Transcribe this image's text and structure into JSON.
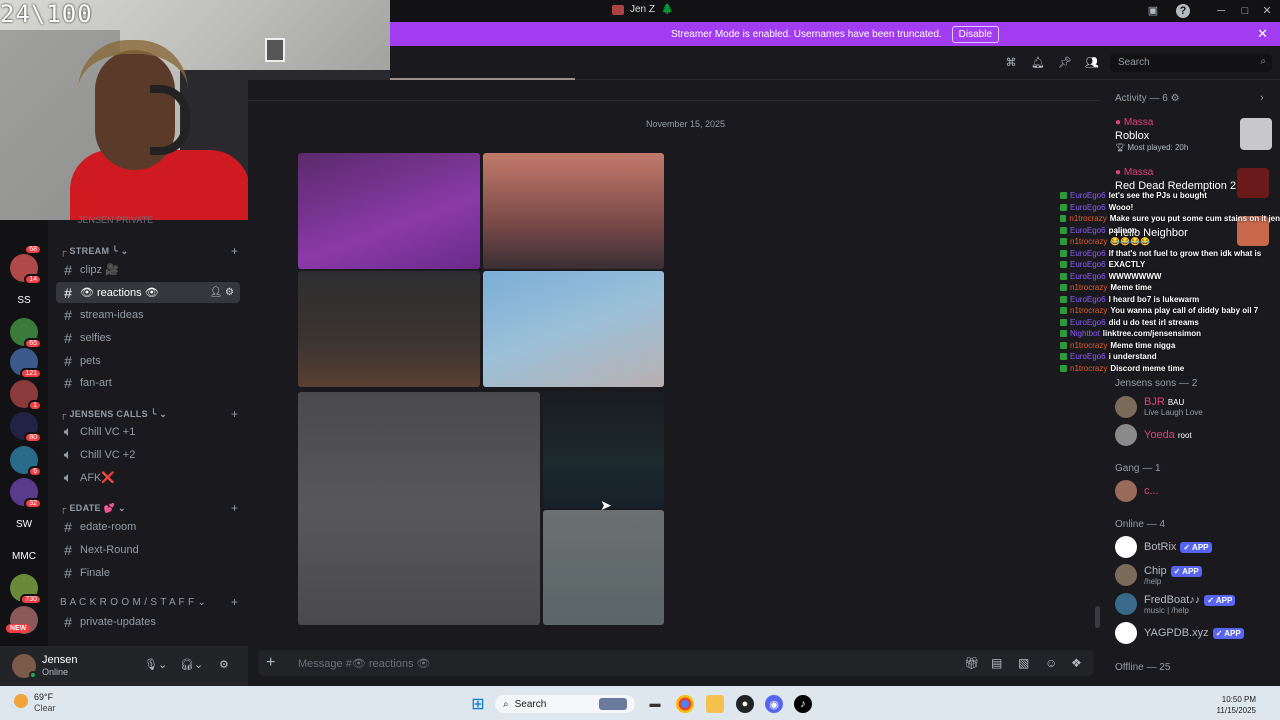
{
  "window": {
    "title": "Jen Z",
    "title_emoji": "🌲",
    "controls": [
      "minimize",
      "maximize",
      "close"
    ]
  },
  "webcam_overlay": "24\\100",
  "banner": {
    "text": "Streamer Mode is enabled. Usernames have been truncated.",
    "button": "Disable"
  },
  "header": {
    "search_placeholder": "Search"
  },
  "guilds": [
    {
      "label": "",
      "badge": "68",
      "color": "#6a5a4a"
    },
    {
      "label": "",
      "badge": "14",
      "color": "#b04a4a"
    },
    {
      "label": "SS",
      "badge": "",
      "color": "#121214"
    },
    {
      "label": "",
      "badge": "65",
      "color": "#3a7a3a"
    },
    {
      "label": "",
      "badge": "121",
      "color": "#3a5a8a"
    },
    {
      "label": "",
      "badge": "1",
      "color": "#8a3a3a"
    },
    {
      "label": "",
      "badge": "80",
      "color": "#222244"
    },
    {
      "label": "",
      "badge": "6",
      "color": "#2a6a8a"
    },
    {
      "label": "",
      "badge": "32",
      "color": "#5a3a8a"
    },
    {
      "label": "SW",
      "badge": "",
      "color": "#121214"
    },
    {
      "label": "MMC",
      "badge": "",
      "color": "#121214"
    },
    {
      "label": "",
      "badge": "730",
      "color": "#6a8a3a"
    },
    {
      "label": "",
      "badge": "NEW",
      "color": "#8a5a5a"
    }
  ],
  "channels": {
    "top_partial": "JENSEN PRIVATE",
    "categories": [
      {
        "name": "STREAM ╰",
        "items": [
          "clipz 🎥",
          "👁 reactions 👁",
          "stream-ideas",
          "selfies",
          "pets",
          "fan-art"
        ]
      },
      {
        "name": "JENSENS CALLS ╰",
        "items": [
          "Chill VC +1",
          "Chill VC +2",
          "AFK❌"
        ]
      },
      {
        "name": "EDATE 💕",
        "items": [
          "edate-room",
          "Next-Round",
          "Finale"
        ]
      },
      {
        "name": "B A C K R O O M / S T A F F",
        "items": [
          "private-updates"
        ]
      }
    ]
  },
  "user": {
    "name": "Jensen",
    "status": "Online"
  },
  "main": {
    "date_separator": "November 15, 2025",
    "composer_placeholder": "Message #👁 reactions 👁"
  },
  "members": {
    "activity_title": "Activity — 6",
    "activities": [
      {
        "user": "Massa",
        "game": "Roblox",
        "detail": "Most played: 20h"
      },
      {
        "user": "Massa",
        "game": "Red Dead Redemption 2",
        "detail": ""
      },
      {
        "user": "",
        "game": "Hello Neighbor",
        "detail": ""
      }
    ],
    "jensens_section": "Jensens sons — 2",
    "jensens": [
      {
        "name": "BJR",
        "tag": "BAU",
        "sub": "Live Laugh Love"
      },
      {
        "name": "Yoeda",
        "tag": "root",
        "sub": ""
      }
    ],
    "gang_title": "Gang — 1",
    "gang": [
      {
        "name": "c..."
      }
    ],
    "online_title": "Online — 4",
    "online": [
      {
        "name": "BotRix",
        "badge": "APP",
        "sub": ""
      },
      {
        "name": "Chip",
        "badge": "APP",
        "sub": "/help"
      },
      {
        "name": "FredBoat♪♪",
        "badge": "APP",
        "sub": "music | /help"
      },
      {
        "name": "YAGPDB.xyz",
        "badge": "APP",
        "sub": ""
      }
    ],
    "offline_title": "Offline — 25"
  },
  "chat_overlay": [
    {
      "user": "EuroEgo6",
      "msg": "let's see the PJs u bought"
    },
    {
      "user": "EuroEgo6",
      "msg": "Wooo!"
    },
    {
      "user": "n1trocrazy",
      "msg": "Make sure you put some cum stains on it jen"
    },
    {
      "user": "EuroEgo6",
      "msg": "palinon"
    },
    {
      "user": "n1trocrazy",
      "msg": "😂😂😂😂"
    },
    {
      "user": "EuroEgo6",
      "msg": "If that's not fuel to grow then idk what is"
    },
    {
      "user": "EuroEgo6",
      "msg": "EXACTLY"
    },
    {
      "user": "EuroEgo6",
      "msg": "WWWWWWW"
    },
    {
      "user": "n1trocrazy",
      "msg": "Meme time"
    },
    {
      "user": "EuroEgo6",
      "msg": "I heard bo7 is lukewarm"
    },
    {
      "user": "n1trocrazy",
      "msg": "You wanna play call of diddy baby oil 7"
    },
    {
      "user": "EuroEgo6",
      "msg": "did u do test irl streams"
    },
    {
      "user": "Nightbot",
      "msg": "linktree.com/jensensimon"
    },
    {
      "user": "n1trocrazy",
      "msg": "Meme time nigga"
    },
    {
      "user": "EuroEgo6",
      "msg": "i understand"
    },
    {
      "user": "n1trocrazy",
      "msg": "Discord meme time"
    }
  ],
  "taskbar": {
    "weather_temp": "69°F",
    "weather_desc": "Clear",
    "search": "Search",
    "time": "10:50 PM",
    "date": "11/15/2025"
  }
}
